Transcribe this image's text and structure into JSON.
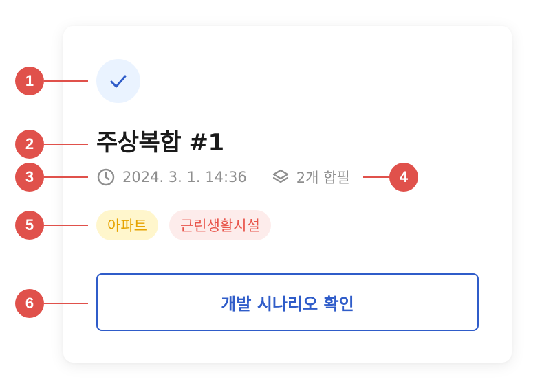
{
  "card": {
    "title": "주상복합 #1",
    "date": "2024. 3. 1. 14:36",
    "parcels": "2개 합필",
    "tags": [
      {
        "label": "아파트",
        "color": "#e6a300",
        "background": "#fff6cc"
      },
      {
        "label": "근린생활시설",
        "color": "#e8554b",
        "background": "#fdeceb"
      }
    ],
    "button_label": "개발 시나리오 확인",
    "icons": {
      "status": "check-icon",
      "time": "clock-icon",
      "parcels": "layers-icon"
    }
  },
  "annotations": {
    "markers": [
      "1",
      "2",
      "3",
      "4",
      "5",
      "6"
    ],
    "color": "#e0514b"
  },
  "colors": {
    "accent": "#2f5cc9",
    "check_background": "#eaf3ff",
    "meta_text": "#8e8e8e"
  }
}
